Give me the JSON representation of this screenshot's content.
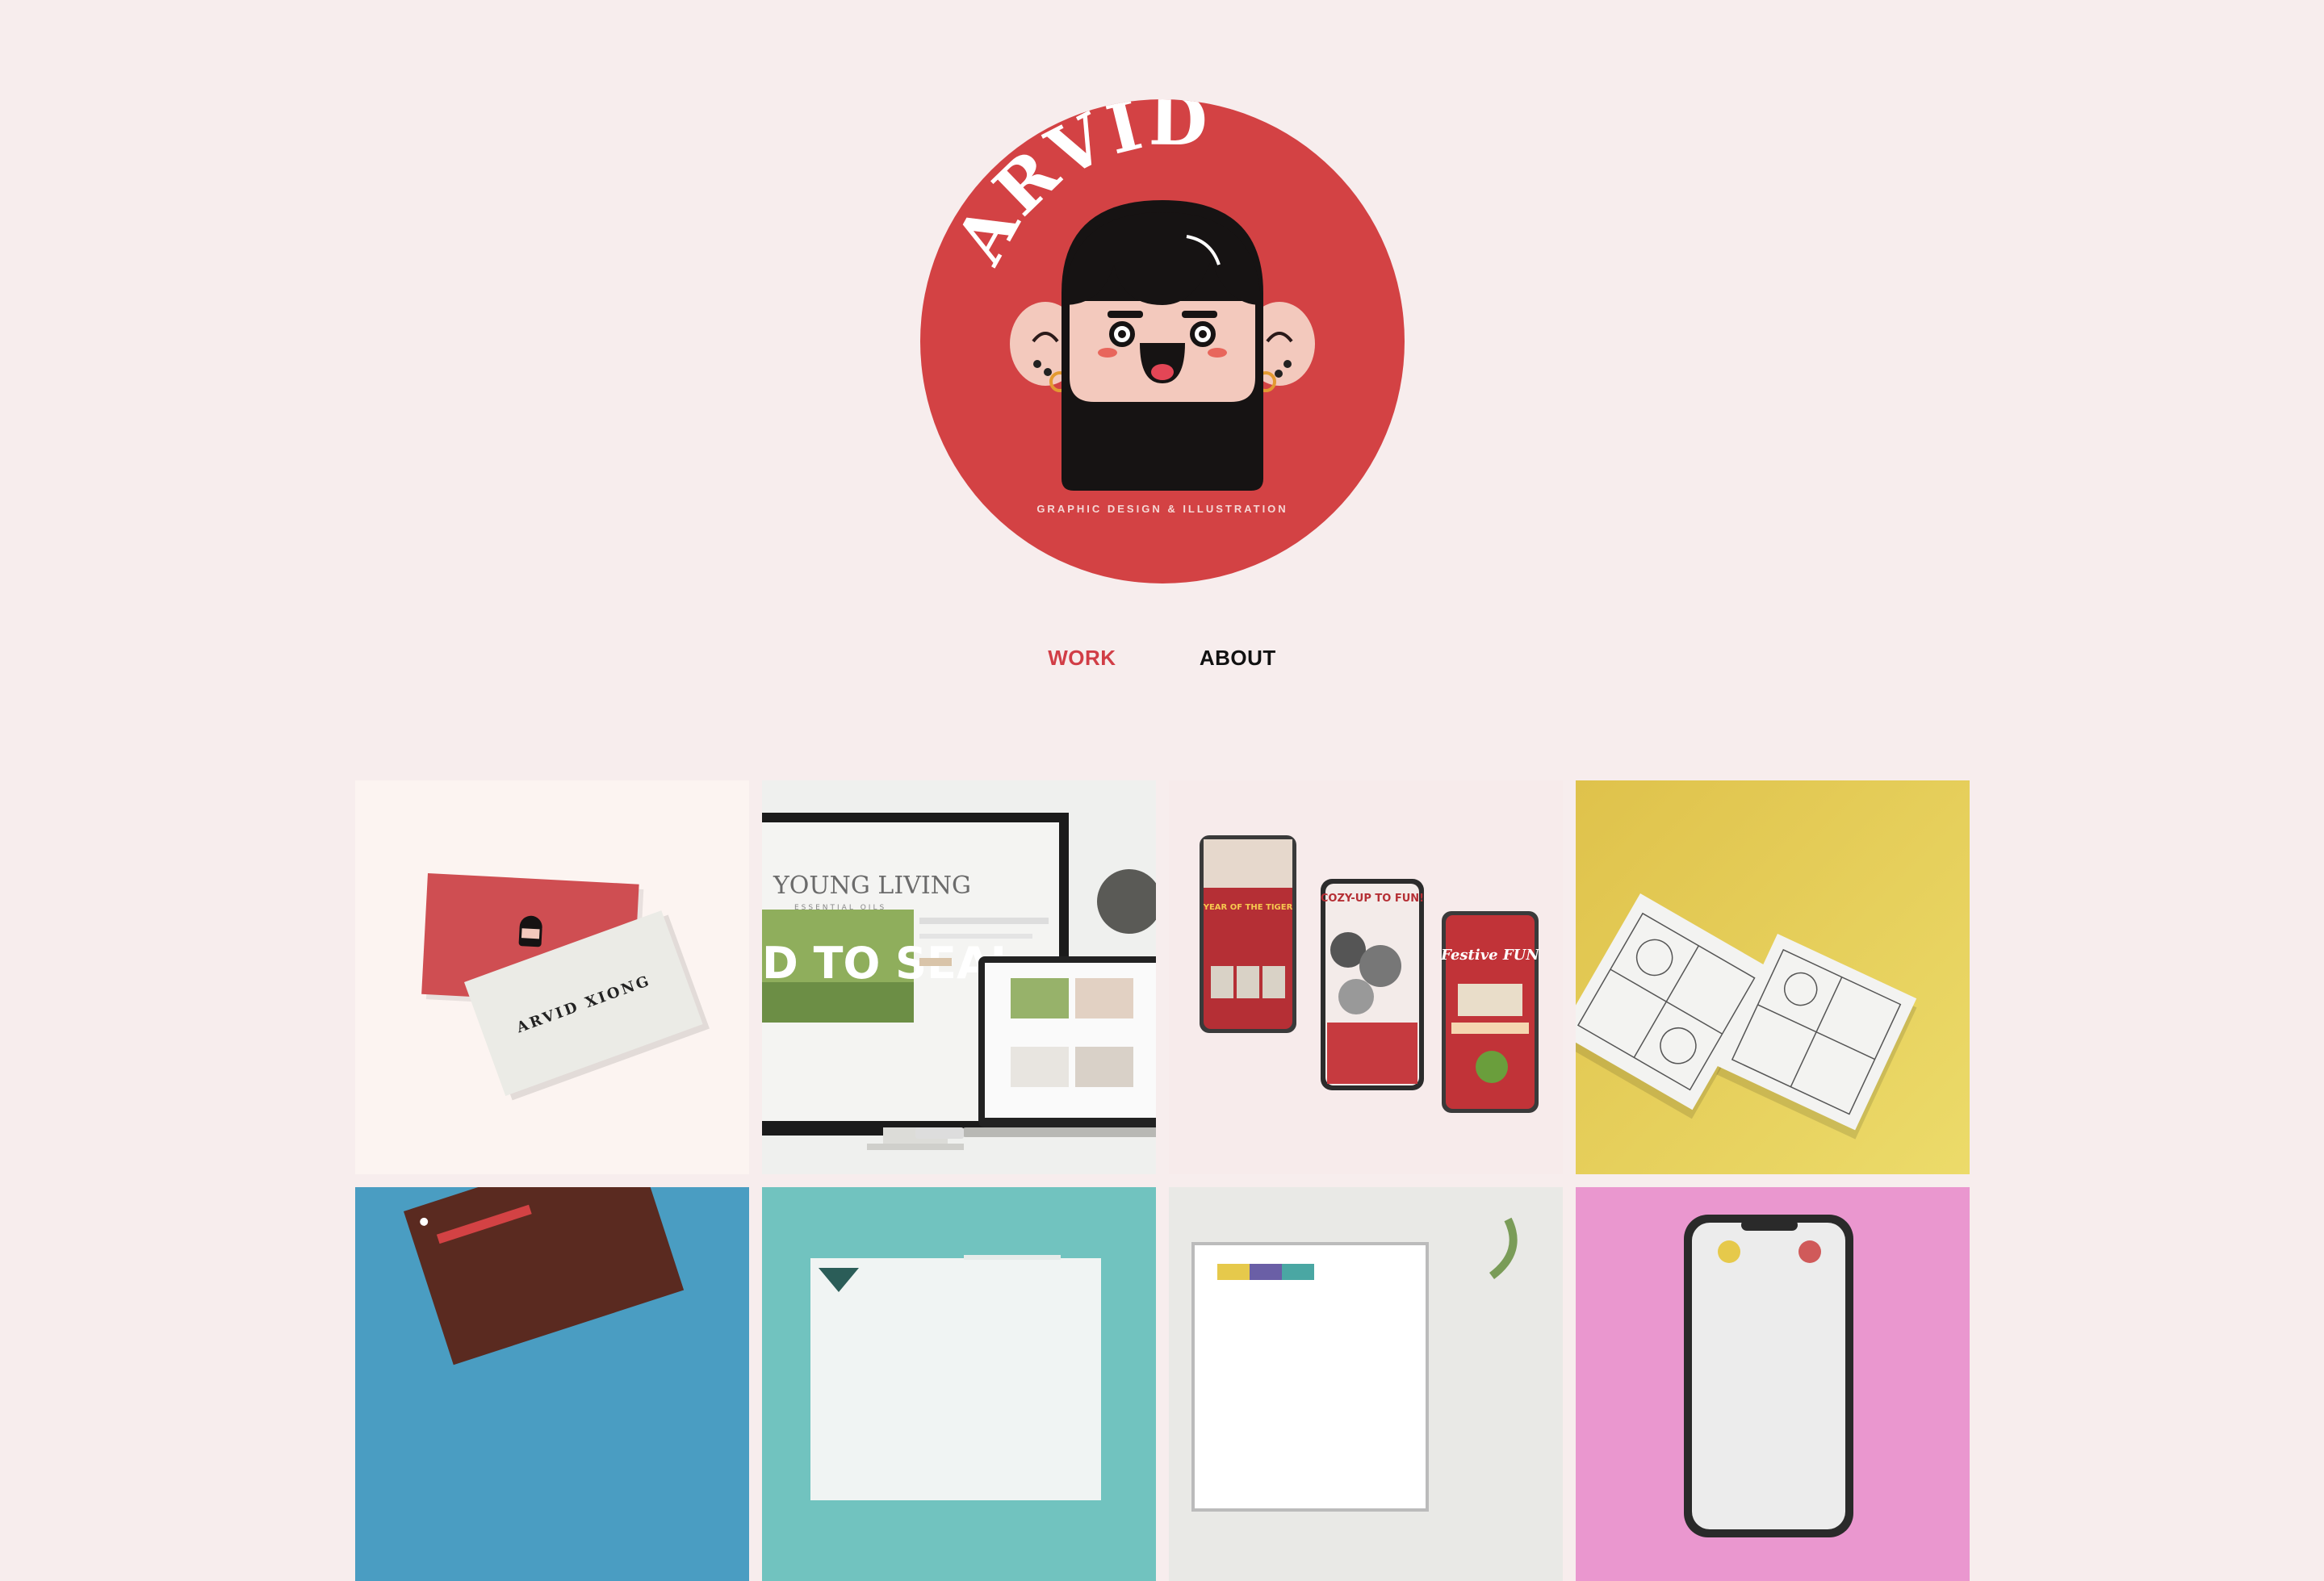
{
  "brand": {
    "name": "ARVID",
    "tagline": "GRAPHIC DESIGN & ILLUSTRATION",
    "accent": "#d34244",
    "background": "#f7eded"
  },
  "nav": {
    "items": [
      {
        "label": "WORK",
        "active": true
      },
      {
        "label": "ABOUT",
        "active": false
      }
    ]
  },
  "work": {
    "projects": [
      {
        "name": "business-cards",
        "card_name": "ARVID XIONG",
        "bg": "#fcf4f1"
      },
      {
        "name": "young-living-website",
        "brand_text": "YOUNG LIVING",
        "sub_text": "ESSENTIAL OILS",
        "hero_text": "D TO SEAL",
        "bg": "#eff0ee"
      },
      {
        "name": "holiday-mobile-ads",
        "headline_1": "YEAR OF THE TIGER",
        "headline_2": "COZY-UP TO FUN!",
        "headline_3": "Festive FUN",
        "bg": "#f7ebeb"
      },
      {
        "name": "coloring-sheets",
        "bg": "#e6c64f"
      },
      {
        "name": "project-5",
        "bg": "#4a9dc2"
      },
      {
        "name": "project-6",
        "bg": "#71c3bf"
      },
      {
        "name": "project-7",
        "bg": "#e9e9e6"
      },
      {
        "name": "project-8",
        "bg": "#ea97cf"
      }
    ]
  }
}
